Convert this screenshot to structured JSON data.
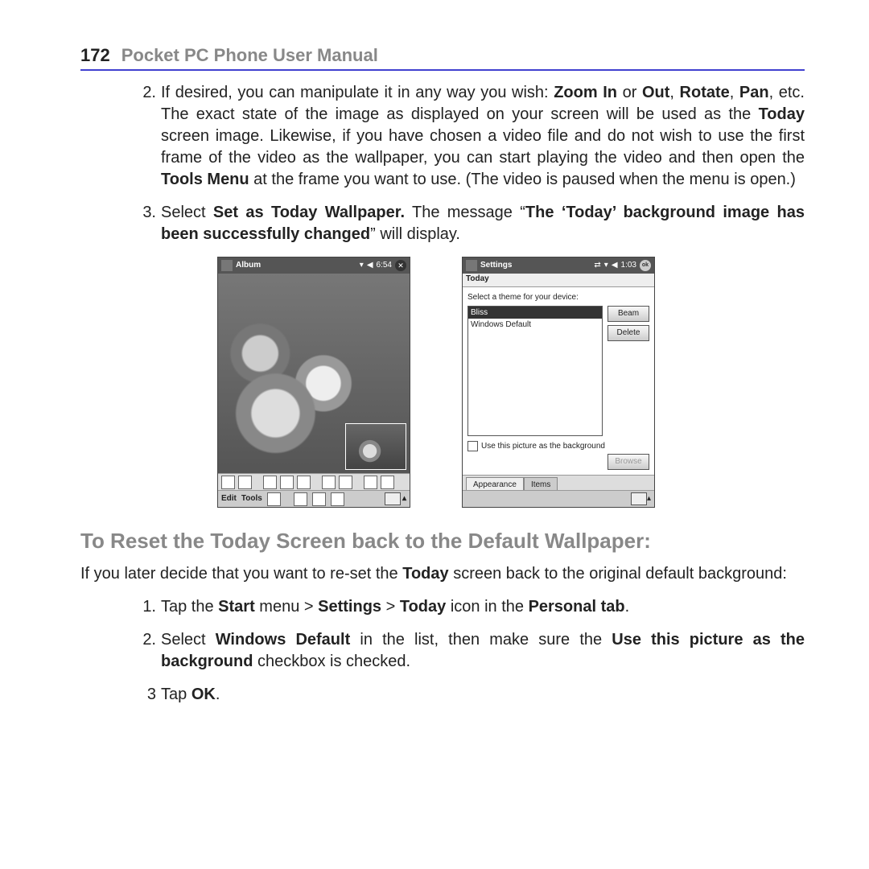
{
  "header": {
    "page_number": "172",
    "manual_title": "Pocket PC Phone User Manual"
  },
  "step2": {
    "num": "2.",
    "p1a": "If desired, you can manipulate it in any way you wish: ",
    "b1": "Zoom In",
    "p1b": " or ",
    "b2": "Out",
    "p1c": ", ",
    "b3": "Rotate",
    "p1d": ", ",
    "b4": "Pan",
    "p1e": ", etc. The exact state of the image as displayed on your screen will be used as the ",
    "b5": "Today",
    "p1f": " screen image. Likewise, if you have chosen a video file and do not wish to use the first frame of the video as the wallpaper, you can start playing the video and then open the ",
    "b6": "Tools Menu",
    "p1g": " at the frame you want to use. (The video is paused when the menu is open.)"
  },
  "step3": {
    "num": "3.",
    "p1a": "Select ",
    "b1": "Set as Today Wallpaper.",
    "p1b": " The message “",
    "b2": "The ‘Today’ background image has been successfully changed",
    "p1c": "” will display."
  },
  "shot1": {
    "title": "Album",
    "time": "6:54",
    "edit": "Edit",
    "tools": "Tools"
  },
  "shot2": {
    "title": "Settings",
    "time": "1:03",
    "ok": "ok",
    "tabbar_title": "Today",
    "label": "Select a theme for your device:",
    "list_selected": "Bliss",
    "list_item2": "Windows Default",
    "btn_beam": "Beam",
    "btn_delete": "Delete",
    "checkbox_label": "Use this picture as the background",
    "btn_browse": "Browse",
    "tab1": "Appearance",
    "tab2": "Items"
  },
  "section_heading": "To Reset the Today Screen back to the Default Wallpaper:",
  "para1": {
    "a": "If you later decide that you want to re-set the ",
    "b": "Today",
    "c": " screen back to the original default background:"
  },
  "r1": {
    "num": "1.",
    "a": "Tap the ",
    "b1": "Start",
    "b": " menu > ",
    "b2": "Settings",
    "c": " > ",
    "b3": "Today",
    "d": " icon in the ",
    "b4": "Personal tab",
    "e": "."
  },
  "r2": {
    "num": "2.",
    "a": "Select ",
    "b1": "Windows Default",
    "b": " in the list, then make sure the ",
    "b2": "Use this picture as the background",
    "c": " checkbox is checked."
  },
  "r3": {
    "num": "3",
    "a": " Tap ",
    "b1": "OK",
    "b": "."
  }
}
